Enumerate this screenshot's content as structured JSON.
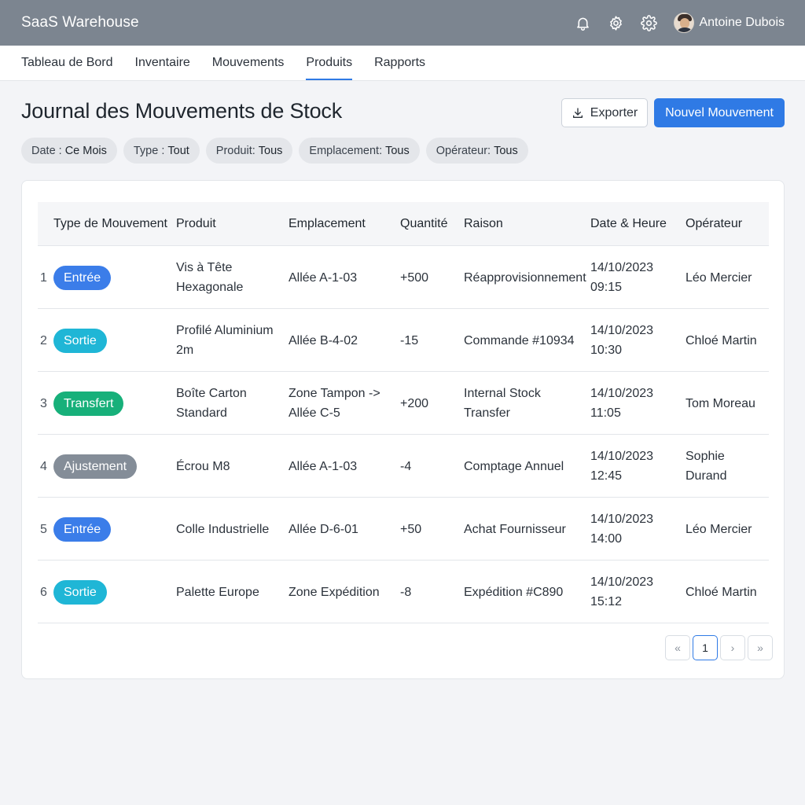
{
  "app": {
    "brand": "SaaS Warehouse",
    "user_name": "Antoine Dubois",
    "accent_color": "#2f7ae5"
  },
  "icons": [
    "bell-icon",
    "settings-gear-icon",
    "cog-icon",
    "avatar"
  ],
  "nav": {
    "items": [
      {
        "label": "Tableau de Bord",
        "active": false
      },
      {
        "label": "Inventaire",
        "active": false
      },
      {
        "label": "Mouvements",
        "active": false
      },
      {
        "label": "Produits",
        "active": true
      },
      {
        "label": "Rapports",
        "active": false
      }
    ]
  },
  "page": {
    "title": "Journal des Mouvements de Stock",
    "export_label": "Exporter",
    "new_label": "Nouvel Mouvement"
  },
  "filters": [
    {
      "key": "Date :",
      "value": "Ce Mois"
    },
    {
      "key": "Type :",
      "value": "Tout"
    },
    {
      "key": "Produit:",
      "value": "Tous"
    },
    {
      "key": "Emplacement:",
      "value": "Tous"
    },
    {
      "key": "Opérateur:",
      "value": "Tous"
    }
  ],
  "table": {
    "headers": [
      "Type de Mouvement",
      "Produit",
      "Emplacement",
      "Quantité",
      "Raison",
      "Date & Heure",
      "Opérateur"
    ],
    "rows": [
      {
        "num": "1",
        "type": "Entrée",
        "type_color": "#3b7de9",
        "product": "Vis à Tête Hexagonale",
        "location": "Allée A-1-03",
        "qty": "+500",
        "reason": "Réapprovisionnement",
        "date": "14/10/2023",
        "time": "09:15",
        "operator": "Léo Mercier"
      },
      {
        "num": "2",
        "type": "Sortie",
        "type_color": "#1fb6d6",
        "product": "Profilé Aluminium 2m",
        "location": "Allée B-4-02",
        "qty": "-15",
        "reason": "Commande #10934",
        "date": "14/10/2023",
        "time": "10:30",
        "operator": "Chloé Martin"
      },
      {
        "num": "3",
        "type": "Transfert",
        "type_color": "#17b07a",
        "product": "Boîte Carton Standard",
        "location": "Zone Tampon -> Allée C-5",
        "qty": "+200",
        "reason": "Internal Stock Transfer",
        "date": "14/10/2023",
        "time": "11:05",
        "operator": "Tom Moreau"
      },
      {
        "num": "4",
        "type": "Ajustement",
        "type_color": "#848d98",
        "product": "Écrou M8",
        "location": "Allée A-1-03",
        "qty": "-4",
        "reason": "Comptage Annuel",
        "date": "14/10/2023",
        "time": "12:45",
        "operator": "Sophie Durand"
      },
      {
        "num": "5",
        "type": "Entrée",
        "type_color": "#3b7de9",
        "product": "Colle Industrielle",
        "location": "Allée D-6-01",
        "qty": "+50",
        "reason": "Achat Fournisseur",
        "date": "14/10/2023",
        "time": "14:00",
        "operator": "Léo Mercier"
      },
      {
        "num": "6",
        "type": "Sortie",
        "type_color": "#1fb6d6",
        "product": "Palette Europe",
        "location": "Zone Expédition",
        "qty": "-8",
        "reason": "Expédition #C890",
        "date": "14/10/2023",
        "time": "15:12",
        "operator": "Chloé Martin"
      }
    ]
  },
  "pagination": {
    "first": "«",
    "current": "1",
    "next": "›",
    "last": "»"
  }
}
